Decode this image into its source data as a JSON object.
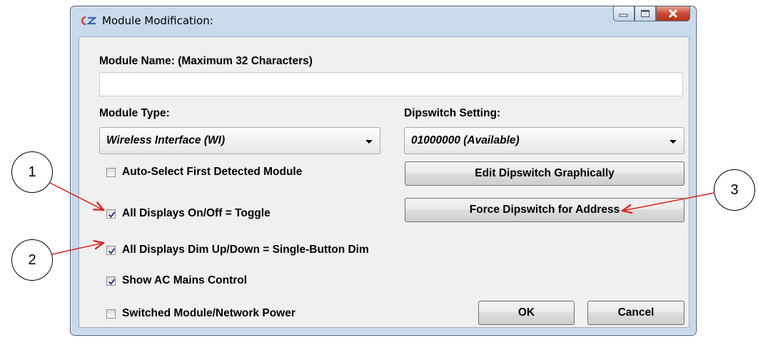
{
  "window": {
    "title": "Module Modification:",
    "icon": "app-logo-icon"
  },
  "caption_buttons": [
    "minimize",
    "maximize",
    "close"
  ],
  "form": {
    "module_name_label": "Module Name: (Maximum 32 Characters)",
    "module_name_value": "",
    "module_type_label": "Module Type:",
    "module_type_value": "Wireless Interface (WI)",
    "dipswitch_label": "Dipswitch Setting:",
    "dipswitch_value": "01000000 (Available)",
    "checkboxes": [
      {
        "label": "Auto-Select First Detected Module",
        "checked": false
      },
      {
        "label": "All Displays On/Off = Toggle",
        "checked": true
      },
      {
        "label": "All Displays Dim Up/Down = Single-Button Dim",
        "checked": true
      },
      {
        "label": "Show AC Mains Control",
        "checked": true
      },
      {
        "label": "Switched Module/Network Power",
        "checked": false
      }
    ],
    "edit_dipswitch_button": "Edit Dipswitch Graphically",
    "force_dipswitch_button": "Force Dipswitch for Address",
    "ok_button": "OK",
    "cancel_button": "Cancel"
  },
  "callouts": [
    "1",
    "2",
    "3"
  ],
  "colors": {
    "window_frame": "#c9daec",
    "content_bg": "#f0f0f0",
    "close_button": "#c8452e",
    "check_mark": "#2b3f86",
    "annotation_arrow": "#e0201a"
  }
}
